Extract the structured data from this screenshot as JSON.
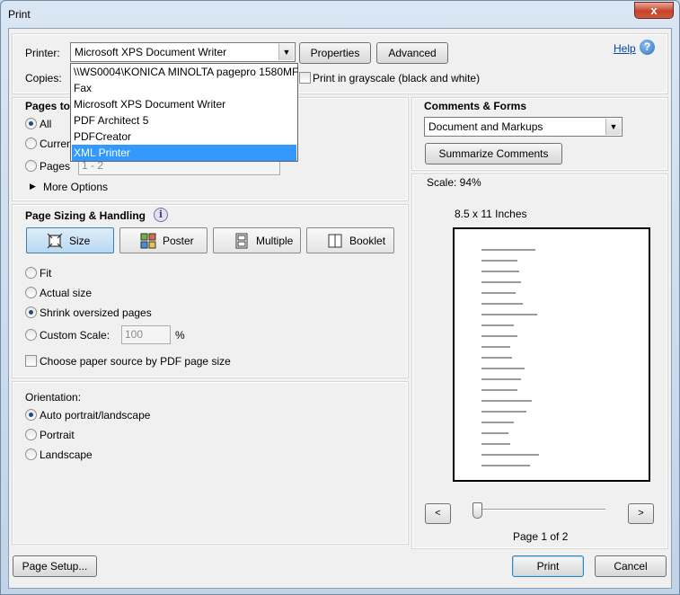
{
  "window": {
    "title": "Print",
    "close_glyph": "x"
  },
  "printer": {
    "label": "Printer:",
    "selected": "Microsoft XPS Document Writer",
    "properties_label": "Properties",
    "advanced_label": "Advanced",
    "help_label": "Help",
    "options": [
      "\\\\WS0004\\KONICA MINOLTA pagepro 1580MF",
      "Fax",
      "Microsoft XPS Document Writer",
      "PDF Architect 5",
      "PDFCreator",
      "XML Printer"
    ],
    "highlighted_option": "XML Printer"
  },
  "copies": {
    "label": "Copies:",
    "grayscale_label": "Print in grayscale (black and white)"
  },
  "pages": {
    "title": "Pages to",
    "all_label": "All",
    "current_label": "Curren",
    "pages_label": "Pages",
    "range_value": "1 - 2",
    "more_options_label": "More Options"
  },
  "sizing": {
    "title": "Page Sizing & Handling",
    "size_label": "Size",
    "poster_label": "Poster",
    "multiple_label": "Multiple",
    "booklet_label": "Booklet",
    "fit_label": "Fit",
    "actual_label": "Actual size",
    "shrink_label": "Shrink oversized pages",
    "custom_label": "Custom Scale:",
    "custom_value": "100",
    "percent": "%",
    "paper_source_label": "Choose paper source by PDF page size"
  },
  "orientation": {
    "title": "Orientation:",
    "auto_label": "Auto portrait/landscape",
    "portrait_label": "Portrait",
    "landscape_label": "Landscape"
  },
  "comments": {
    "title": "Comments & Forms",
    "selected": "Document and Markups",
    "summarize_label": "Summarize Comments"
  },
  "preview": {
    "scale_text": "Scale:  94%",
    "paper_size": "8.5 x 11 Inches",
    "page_indicator": "Page 1 of 2",
    "prev_glyph": "<",
    "next_glyph": ">"
  },
  "footer": {
    "page_setup_label": "Page Setup...",
    "print_label": "Print",
    "cancel_label": "Cancel"
  }
}
